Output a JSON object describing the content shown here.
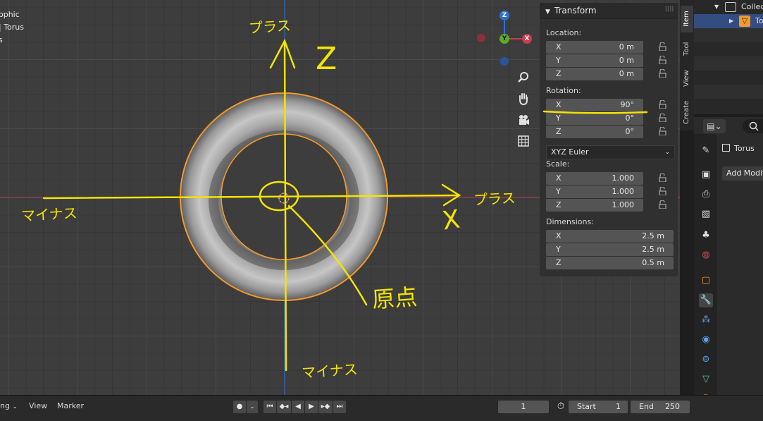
{
  "viewport": {
    "overlay_lines": [
      "ophic",
      "| Torus",
      "s"
    ],
    "annotations": {
      "top_plus": "プラス",
      "z_label": "Z",
      "right_plus": "プラス",
      "x_label": "X",
      "left_minus": "マイナス",
      "bottom_minus": "マイナス",
      "origin": "原点"
    },
    "gizmo": {
      "z": "Z",
      "y": "Y",
      "x": "X"
    },
    "nav_icons": [
      "zoom-icon",
      "hand-icon",
      "camera-icon",
      "grid-icon"
    ]
  },
  "npanel": {
    "header": "Transform",
    "location_label": "Location:",
    "location": [
      {
        "axis": "X",
        "value": "0 m"
      },
      {
        "axis": "Y",
        "value": "0 m"
      },
      {
        "axis": "Z",
        "value": "0 m"
      }
    ],
    "rotation_label": "Rotation:",
    "rotation": [
      {
        "axis": "X",
        "value": "90°"
      },
      {
        "axis": "Y",
        "value": "0°"
      },
      {
        "axis": "Z",
        "value": "0°"
      }
    ],
    "rotation_mode": "XYZ Euler",
    "scale_label": "Scale:",
    "scale": [
      {
        "axis": "X",
        "value": "1.000"
      },
      {
        "axis": "Y",
        "value": "1.000"
      },
      {
        "axis": "Z",
        "value": "1.000"
      }
    ],
    "dimensions_label": "Dimensions:",
    "dimensions": [
      {
        "axis": "X",
        "value": "2.5 m"
      },
      {
        "axis": "Y",
        "value": "2.5 m"
      },
      {
        "axis": "Z",
        "value": "0.5 m"
      }
    ]
  },
  "tabs": [
    "Item",
    "Tool",
    "View",
    "Create"
  ],
  "outliner": {
    "collection": "Collec",
    "object": "To"
  },
  "properties": {
    "object_name": "Torus",
    "add_modifier": "Add Modifi"
  },
  "timeline": {
    "mode": "ng",
    "view": "View",
    "marker": "Marker",
    "current_frame": "1",
    "start_label": "Start",
    "start_value": "1",
    "end_label": "End",
    "end_value": "250"
  },
  "colors": {
    "annotation": "#f5e400",
    "selection": "#f39a2b",
    "x_axis": "#cc3b4e",
    "z_axis": "#2f6fd1",
    "y_gizmo": "#5aad2a"
  }
}
